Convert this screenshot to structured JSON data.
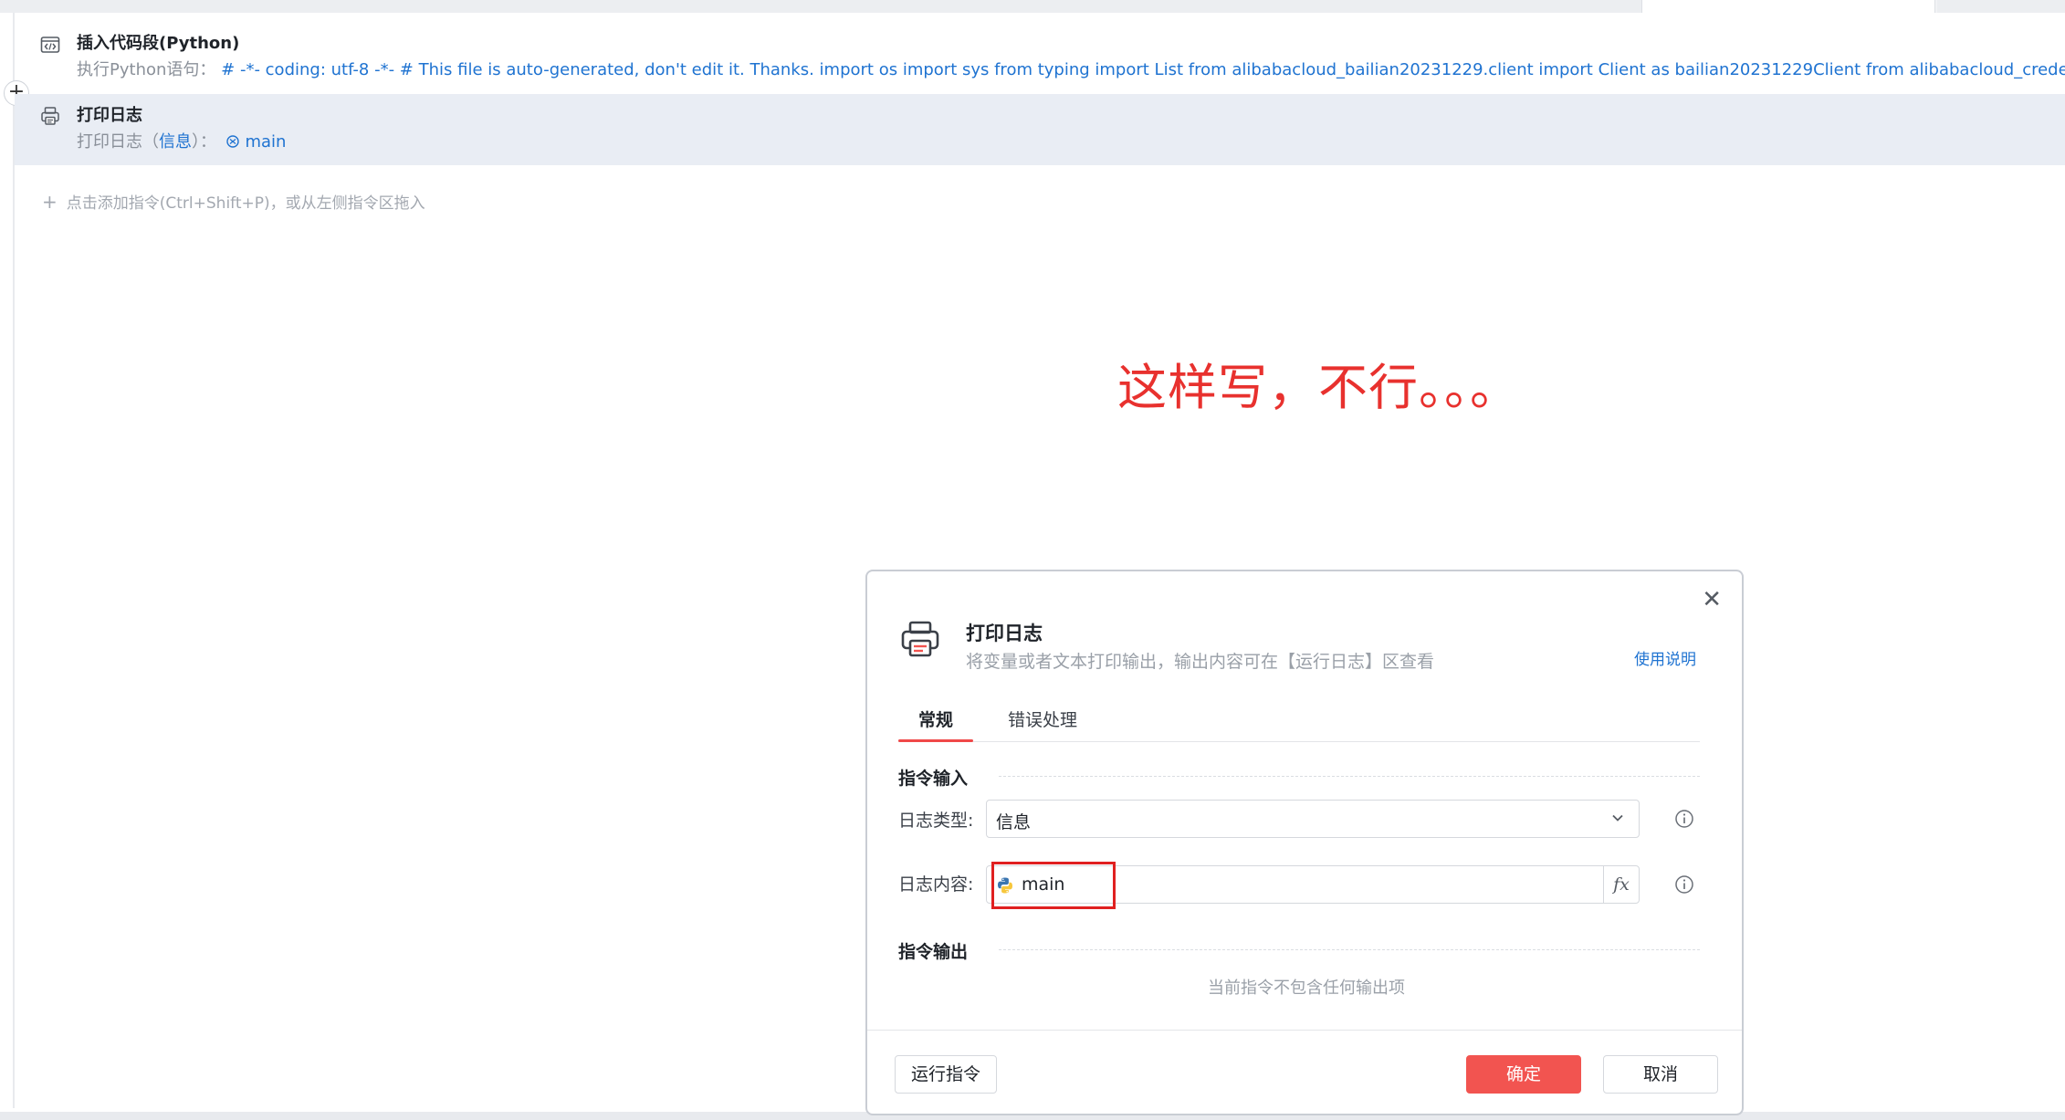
{
  "rows": {
    "python": {
      "title": "插入代码段(Python)",
      "desc_prefix": "执行Python语句：",
      "desc_code": "# -*- coding: utf-8 -*- # This file is auto-generated, don't edit it. Thanks. import os import sys  from typing import List  from alibabacloud_bailian20231229.client import Client as bailian20231229Client from alibabacloud_credentials.client"
    },
    "log": {
      "title": "打印日志",
      "desc_prefix": "打印日志（",
      "desc_type": "信息",
      "desc_mid": "）：",
      "desc_value": "main"
    }
  },
  "add_hint": "点击添加指令(Ctrl+Shift+P)，或从左侧指令区拖入",
  "annotation": "这样写，不行。。。",
  "dialog": {
    "title": "打印日志",
    "subtitle": "将变量或者文本打印输出，输出内容可在【运行日志】区查看",
    "help_link": "使用说明",
    "tabs": [
      "常规",
      "错误处理"
    ],
    "input_section": "指令输入",
    "log_type_label": "日志类型:",
    "log_type_value": "信息",
    "log_content_label": "日志内容:",
    "log_content_value": "main",
    "fx_label": "fx",
    "output_section": "指令输出",
    "no_output_text": "当前指令不包含任何输出项",
    "run_button": "运行指令",
    "ok_button": "确定",
    "cancel_button": "取消"
  },
  "colors": {
    "accent_red": "#f25450",
    "link_blue": "#1f73d1",
    "annotation_red": "#e8312e",
    "selected_row_bg": "#e9edf4"
  },
  "icons": {
    "python_row": "code-block-icon",
    "log_row": "printer-icon",
    "dialog": "printer-icon",
    "close": "close-icon",
    "dropdown": "chevron-down-icon",
    "info": "info-icon",
    "python_var": "python-icon",
    "variable": "variable-icon"
  }
}
